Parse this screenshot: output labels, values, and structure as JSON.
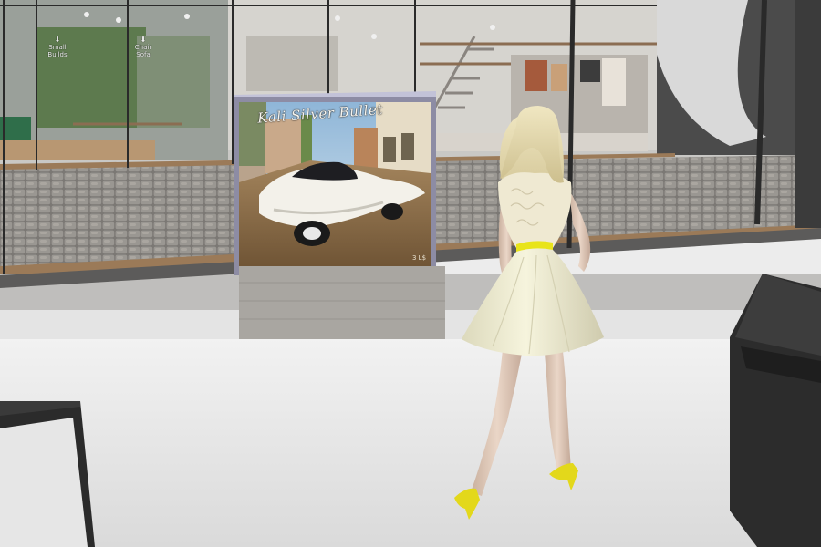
{
  "scene": {
    "store_signs": [
      {
        "arrow": "⬇",
        "line1": "Small",
        "line2": "Builds"
      },
      {
        "arrow": "⬇",
        "line1": "Chair",
        "line2": "Sofa"
      }
    ],
    "vendor_poster": {
      "title": "Kali Silver Bullet",
      "price": "3 L$"
    }
  },
  "colors": {
    "floor": "#ececec",
    "dress": "#f1efd2",
    "belt": "#e8e41a",
    "shoes": "#e3d81b",
    "hair": "#e6dcae",
    "car": "#f3f1ea",
    "glass_frame": "#2a2a2a",
    "kiosk": "#2c2c2c"
  }
}
